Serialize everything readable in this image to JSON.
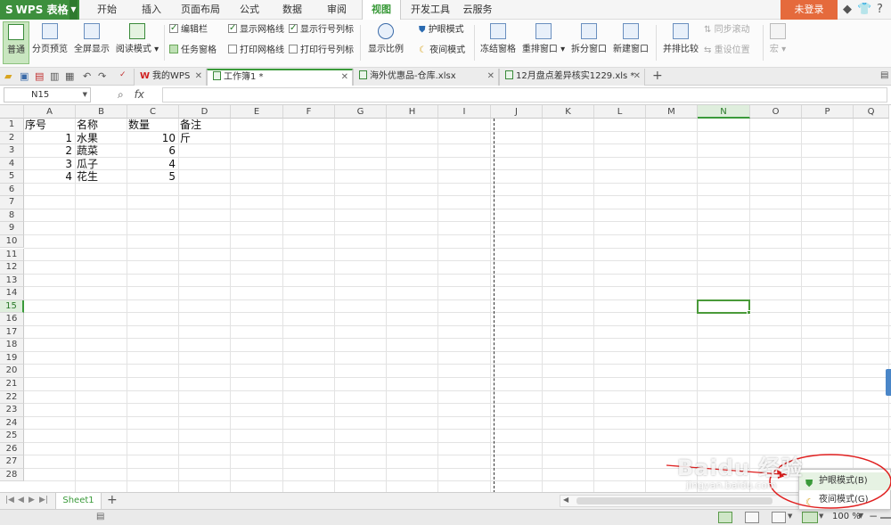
{
  "app": {
    "logo": "WPS 表格",
    "login": "未登录"
  },
  "menu": {
    "tabs": [
      "开始",
      "插入",
      "页面布局",
      "公式",
      "数据",
      "审阅",
      "视图",
      "开发工具",
      "云服务"
    ],
    "active": "视图"
  },
  "ribbon": {
    "normal": "普通",
    "page_preview": "分页预览",
    "fullscreen": "全屏显示",
    "reading_mode": "阅读模式",
    "edit_bar": "编辑栏",
    "task_pane": "任务窗格",
    "show_gridlines": "显示网格线",
    "print_gridlines": "打印网格线",
    "show_headers": "显示行号列标",
    "print_headers": "打印行号列标",
    "zoom_ratio": "显示比例",
    "eye_mode": "护眼模式",
    "night_mode": "夜间模式",
    "freeze": "冻结窗格",
    "arrange": "重排窗口",
    "split": "拆分窗口",
    "new_window": "新建窗口",
    "side_by_side": "并排比较",
    "sync_scroll": "同步滚动",
    "reset_position": "重设位置",
    "macro": "宏"
  },
  "doc_tabs": [
    {
      "label": "我的WPS",
      "active": false
    },
    {
      "label": "工作簿1 *",
      "active": true
    },
    {
      "label": "海外优惠品-仓库.xlsx",
      "active": false
    },
    {
      "label": "12月盘点差异核实1229.xls *",
      "active": false
    }
  ],
  "formula": {
    "cell_ref": "N15",
    "fx": "fx",
    "value": ""
  },
  "grid": {
    "columns": [
      "A",
      "B",
      "C",
      "D",
      "E",
      "F",
      "G",
      "H",
      "I",
      "J",
      "K",
      "L",
      "M",
      "N",
      "O",
      "P",
      "Q"
    ],
    "selected_column": "N",
    "rows": [
      "1",
      "2",
      "3",
      "4",
      "5",
      "6",
      "7",
      "8",
      "9",
      "10",
      "11",
      "12",
      "13",
      "14",
      "15",
      "16",
      "17",
      "18",
      "19",
      "20",
      "21",
      "22",
      "23",
      "24",
      "25",
      "26",
      "27",
      "28"
    ],
    "selected_row": "15",
    "cells": {
      "A1": "序号",
      "B1": "名称",
      "C1": "数量",
      "D1": "备注",
      "A2": "1",
      "B2": "水果",
      "C2": "10",
      "D2": "斤",
      "A3": "2",
      "B3": "蔬菜",
      "C3": "6",
      "A4": "3",
      "B4": "瓜子",
      "C4": "4",
      "A5": "4",
      "B5": "花生",
      "C5": "5"
    }
  },
  "sheets": {
    "active": "Sheet1",
    "add": "+"
  },
  "statusbar": {
    "zoom": "100 %"
  },
  "popup": {
    "items": [
      "护眼模式(B)",
      "夜间模式(G)"
    ]
  },
  "watermark": {
    "main": "Baidu 经验",
    "sub": "jingyan.baidu.com"
  },
  "colors": {
    "accent": "#3a9a3a",
    "login": "#e56a3c",
    "annotation": "#e02020"
  }
}
